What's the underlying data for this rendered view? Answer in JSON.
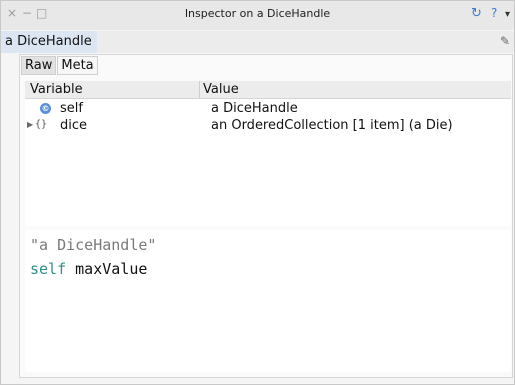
{
  "window": {
    "title": "Inspector on a DiceHandle",
    "controls": {
      "close": "×",
      "minimize": "−",
      "maximize": "□"
    },
    "right_icons": {
      "refresh": "↻",
      "help": "?",
      "menu": "▾"
    }
  },
  "object_tab": {
    "label": "a DiceHandle"
  },
  "subtabs": [
    {
      "label": "Raw",
      "selected": true
    },
    {
      "label": "Meta",
      "selected": false
    }
  ],
  "table": {
    "headers": [
      "Variable",
      "Value"
    ],
    "rows": [
      {
        "variable": "self",
        "value": "a DiceHandle",
        "icon": "self-icon"
      },
      {
        "variable": "dice",
        "value": "an OrderedCollection [1 item] (a Die)",
        "icon": "collection-icon",
        "expandable": true
      }
    ]
  },
  "code": {
    "comment": "\"a DiceHandle\"",
    "receiver": "self",
    "selector": "maxValue"
  },
  "colors": {
    "accent_tab": "#dce6f2",
    "keyword": "#2f8f8a",
    "comment": "#7a7a7a",
    "self_icon": "#5b8fd6"
  }
}
